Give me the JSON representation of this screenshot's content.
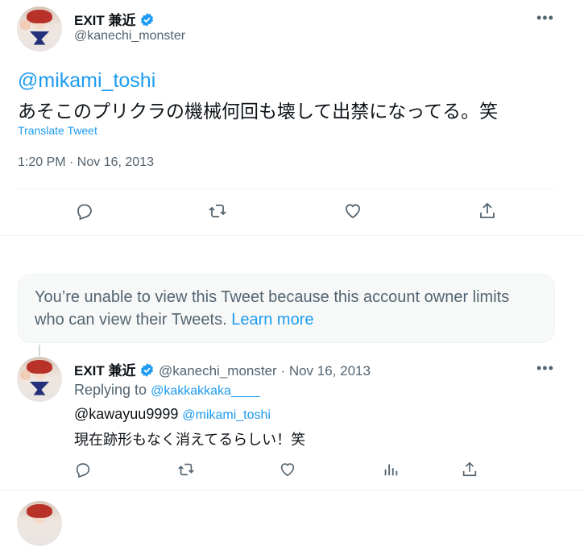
{
  "main_tweet": {
    "display_name": "EXIT 兼近",
    "handle": "@kanechi_monster",
    "mention": "@mikami_toshi",
    "text": "あそこのプリクラの機械何回も壊して出禁になってる。笑",
    "translate_label": "Translate Tweet",
    "timestamp": "1:20 PM · Nov 16, 2013",
    "more_icon": "ellipsis-icon"
  },
  "main_actions": [
    "reply-icon",
    "retweet-icon",
    "like-icon",
    "share-icon"
  ],
  "unavailable_notice": {
    "text": "You’re unable to view this Tweet because this account owner limits who can view their Tweets.",
    "link": "Learn more"
  },
  "reply_tweet": {
    "display_name": "EXIT 兼近",
    "handle": "@kanechi_monster",
    "date": "· Nov 16, 2013",
    "replying_to_label": "Replying to",
    "replying_to_handle": "@kakkakkaka____",
    "mention_1": "@kawayuu9999",
    "mention_2": "@mikami_toshi",
    "text": "現在跡形もなく消えてるらしい！笑"
  },
  "reply_actions": [
    "reply-icon",
    "retweet-icon",
    "like-icon",
    "views-icon",
    "share-icon"
  ],
  "colors": {
    "accent": "#1d9bf0",
    "text": "#0f1419",
    "secondary": "#536471",
    "notice_bg": "#f7f9f9"
  }
}
